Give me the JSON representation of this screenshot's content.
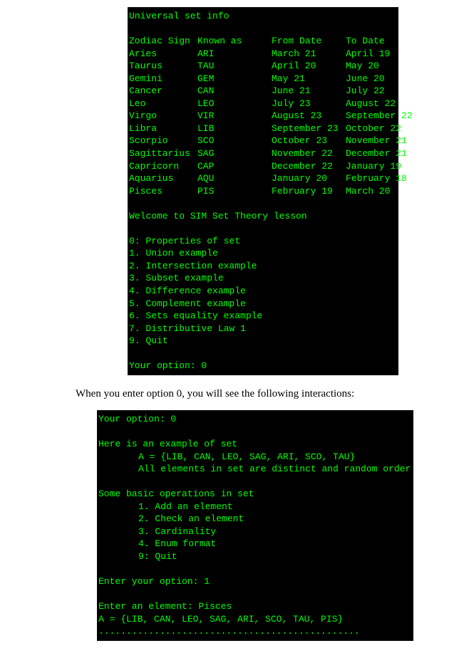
{
  "terminal1": {
    "title": "Universal set info",
    "headers": {
      "sign": "Zodiac Sign",
      "known": "Known as",
      "from": "From Date",
      "to": "To Date"
    },
    "rows": [
      {
        "sign": "Aries",
        "known": "ARI",
        "from": "March 21",
        "to": "April 19"
      },
      {
        "sign": "Taurus",
        "known": "TAU",
        "from": "April 20",
        "to": "May 20"
      },
      {
        "sign": "Gemini",
        "known": "GEM",
        "from": "May 21",
        "to": "June 20"
      },
      {
        "sign": "Cancer",
        "known": "CAN",
        "from": "June 21",
        "to": "July 22"
      },
      {
        "sign": "Leo",
        "known": "LEO",
        "from": "July 23",
        "to": "August 22"
      },
      {
        "sign": "Virgo",
        "known": "VIR",
        "from": "August 23",
        "to": "September 22"
      },
      {
        "sign": "Libra",
        "known": "LIB",
        "from": "September 23",
        "to": "October 22"
      },
      {
        "sign": "Scorpio",
        "known": "SCO",
        "from": "October 23",
        "to": "November 21"
      },
      {
        "sign": "Sagittarius",
        "known": "SAG",
        "from": "November 22",
        "to": "December 21"
      },
      {
        "sign": "Capricorn",
        "known": "CAP",
        "from": "December 22",
        "to": "January 19"
      },
      {
        "sign": "Aquarius",
        "known": "AQU",
        "from": "January 20",
        "to": "February 18"
      },
      {
        "sign": "Pisces",
        "known": "PIS",
        "from": "February 19",
        "to": "March 20"
      }
    ],
    "welcome": "Welcome to SIM Set Theory lesson",
    "menu": [
      "0: Properties of set",
      "1. Union example",
      "2. Intersection example",
      "3. Subset example",
      "4. Difference example",
      "5. Complement example",
      "6. Sets equality example",
      "7. Distributive Law 1",
      "9. Quit"
    ],
    "prompt": "Your option: 0"
  },
  "doc_text": "When you enter option 0, you will see the following interactions:",
  "terminal2": {
    "prompt": "Your option: 0",
    "example_title": "Here is an example of set",
    "example_set": "A = {LIB, CAN, LEO, SAG, ARI, SCO, TAU}",
    "example_note": "All elements in set are distinct and random order",
    "ops_title": "Some basic operations in set",
    "ops": [
      "1. Add an element",
      "2. Check an element",
      "3. Cardinality",
      "4. Enum format",
      "9: Quit"
    ],
    "enter_prompt": "Enter your option: 1",
    "enter_element": "Enter an element: Pisces",
    "result_set": "A = {LIB, CAN, LEO, SAG, ARI, SCO, TAU, PIS}",
    "dots": "..............................................."
  }
}
